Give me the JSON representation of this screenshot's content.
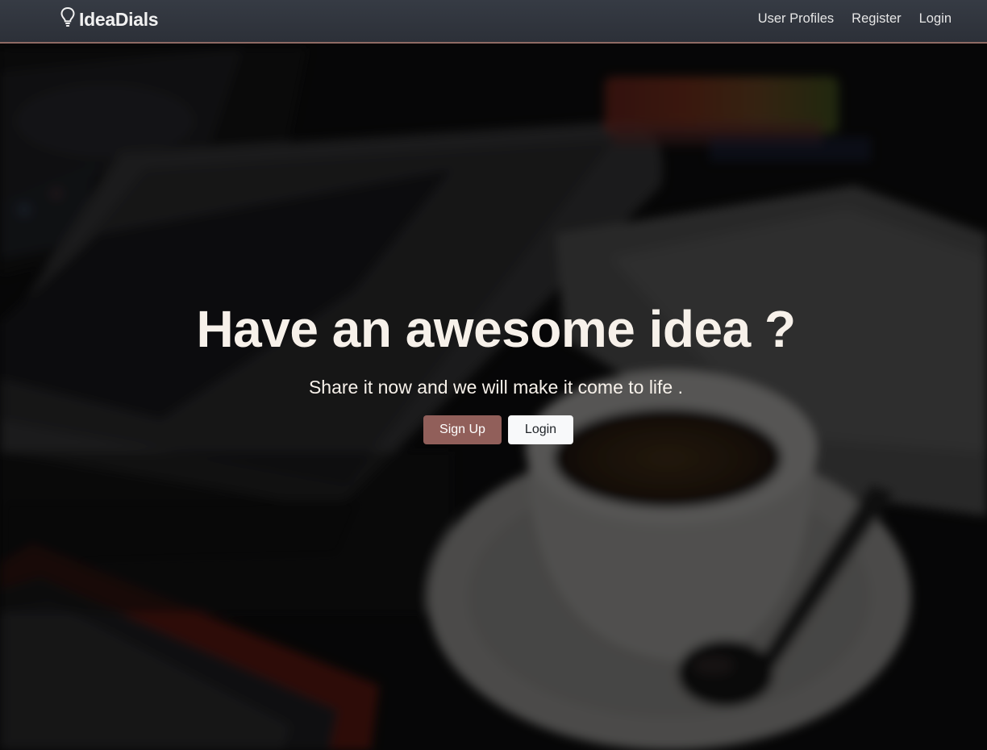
{
  "navbar": {
    "brand": "IdeaDials",
    "brand_icon": "lightbulb-icon",
    "links": [
      {
        "label": "User Profiles"
      },
      {
        "label": "Register"
      },
      {
        "label": "Login"
      }
    ]
  },
  "hero": {
    "title": "Have an awesome idea ?",
    "subtitle": "Share it now and we will make it come to life .",
    "signup_label": "Sign Up",
    "login_label": "Login"
  },
  "colors": {
    "navbar_bg": "#30343c",
    "navbar_border": "#8e6a64",
    "accent": "#915f5a",
    "hero_text": "#f7f1ea"
  }
}
